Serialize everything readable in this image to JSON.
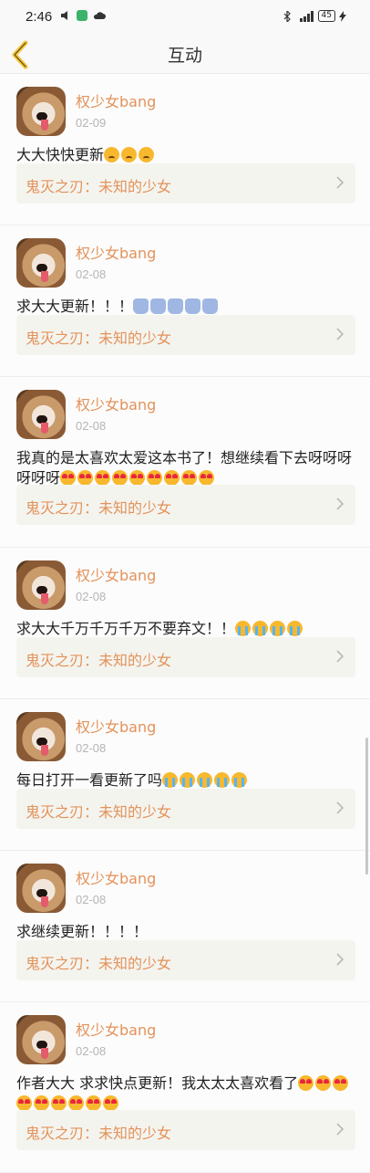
{
  "status": {
    "time": "2:46",
    "battery": "45"
  },
  "header": {
    "title": "互动"
  },
  "items": [
    {
      "user": "权少女bang",
      "date": "02-09",
      "text": "大大快快更新",
      "emoji": "sad",
      "emoji_count": 3,
      "book": "鬼灭之刃：未知的少女"
    },
    {
      "user": "权少女bang",
      "date": "02-08",
      "text": "求大大更新！！！",
      "emoji": "pray",
      "emoji_count": 5,
      "book": "鬼灭之刃：未知的少女"
    },
    {
      "user": "权少女bang",
      "date": "02-08",
      "text": "我真的是太喜欢太爱这本书了！想继续看下去呀呀呀呀呀呀",
      "emoji": "love",
      "emoji_count": 9,
      "book": "鬼灭之刃：未知的少女"
    },
    {
      "user": "权少女bang",
      "date": "02-08",
      "text": "求大大千万千万千万不要弃文！！",
      "emoji": "cry",
      "emoji_count": 4,
      "book": "鬼灭之刃：未知的少女"
    },
    {
      "user": "权少女bang",
      "date": "02-08",
      "text": "每日打开一看更新了吗",
      "emoji": "cry",
      "emoji_count": 5,
      "book": "鬼灭之刃：未知的少女"
    },
    {
      "user": "权少女bang",
      "date": "02-08",
      "text": "求继续更新！！！！",
      "emoji": "",
      "emoji_count": 0,
      "book": "鬼灭之刃：未知的少女"
    },
    {
      "user": "权少女bang",
      "date": "02-08",
      "text": "作者大大 求求快点更新！我太太太喜欢看了",
      "emoji": "love",
      "emoji_count": 9,
      "book": "鬼灭之刃：未知的少女"
    }
  ]
}
